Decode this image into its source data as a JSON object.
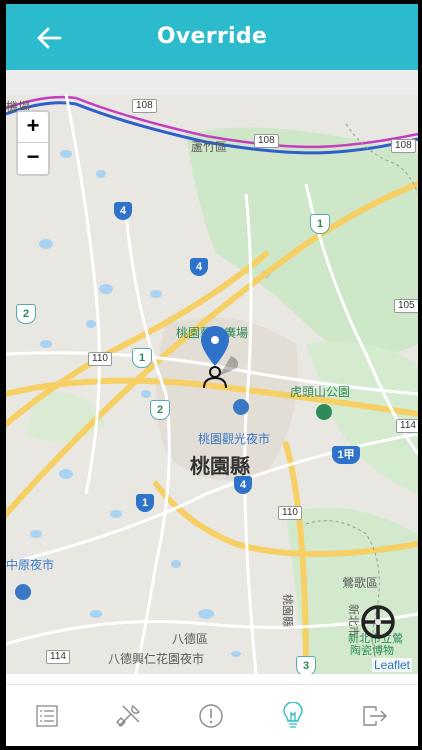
{
  "header": {
    "title": "Override"
  },
  "map": {
    "attribution": "Leaflet",
    "zoom_in_label": "+",
    "zoom_out_label": "−",
    "labels": {
      "luzhu": "蘆竹區",
      "county": "桃園縣",
      "plaza": "桃園藝文廣場",
      "night_market": "桃園觀光夜市",
      "hutoushan": "虎頭山公園",
      "bade": "八德區",
      "bade_market": "八德興仁花園夜市",
      "yingge": "鶯歌區",
      "zhongyuan": "中原夜市",
      "airport": "機場",
      "newtaipei": "新北市",
      "museum_1": "新北市立鶯",
      "museum_2": "陶瓷博物"
    },
    "route_shields": [
      "108",
      "108",
      "108",
      "105",
      "110",
      "110",
      "114",
      "114",
      "4",
      "4",
      "4",
      "1",
      "1",
      "1",
      "2",
      "2",
      "3",
      "1甲"
    ]
  },
  "tabs": [
    {
      "name": "list",
      "icon": "list-icon"
    },
    {
      "name": "tools",
      "icon": "tools-icon"
    },
    {
      "name": "alert",
      "icon": "alert-icon"
    },
    {
      "name": "override",
      "icon": "lightbulb-icon",
      "active": true
    },
    {
      "name": "logout",
      "icon": "logout-icon"
    }
  ],
  "colors": {
    "header": "#2bbbcc",
    "active_tab": "#2bbbcc",
    "inactive_tab": "#8a8a8a",
    "marker": "#2f72c9"
  }
}
